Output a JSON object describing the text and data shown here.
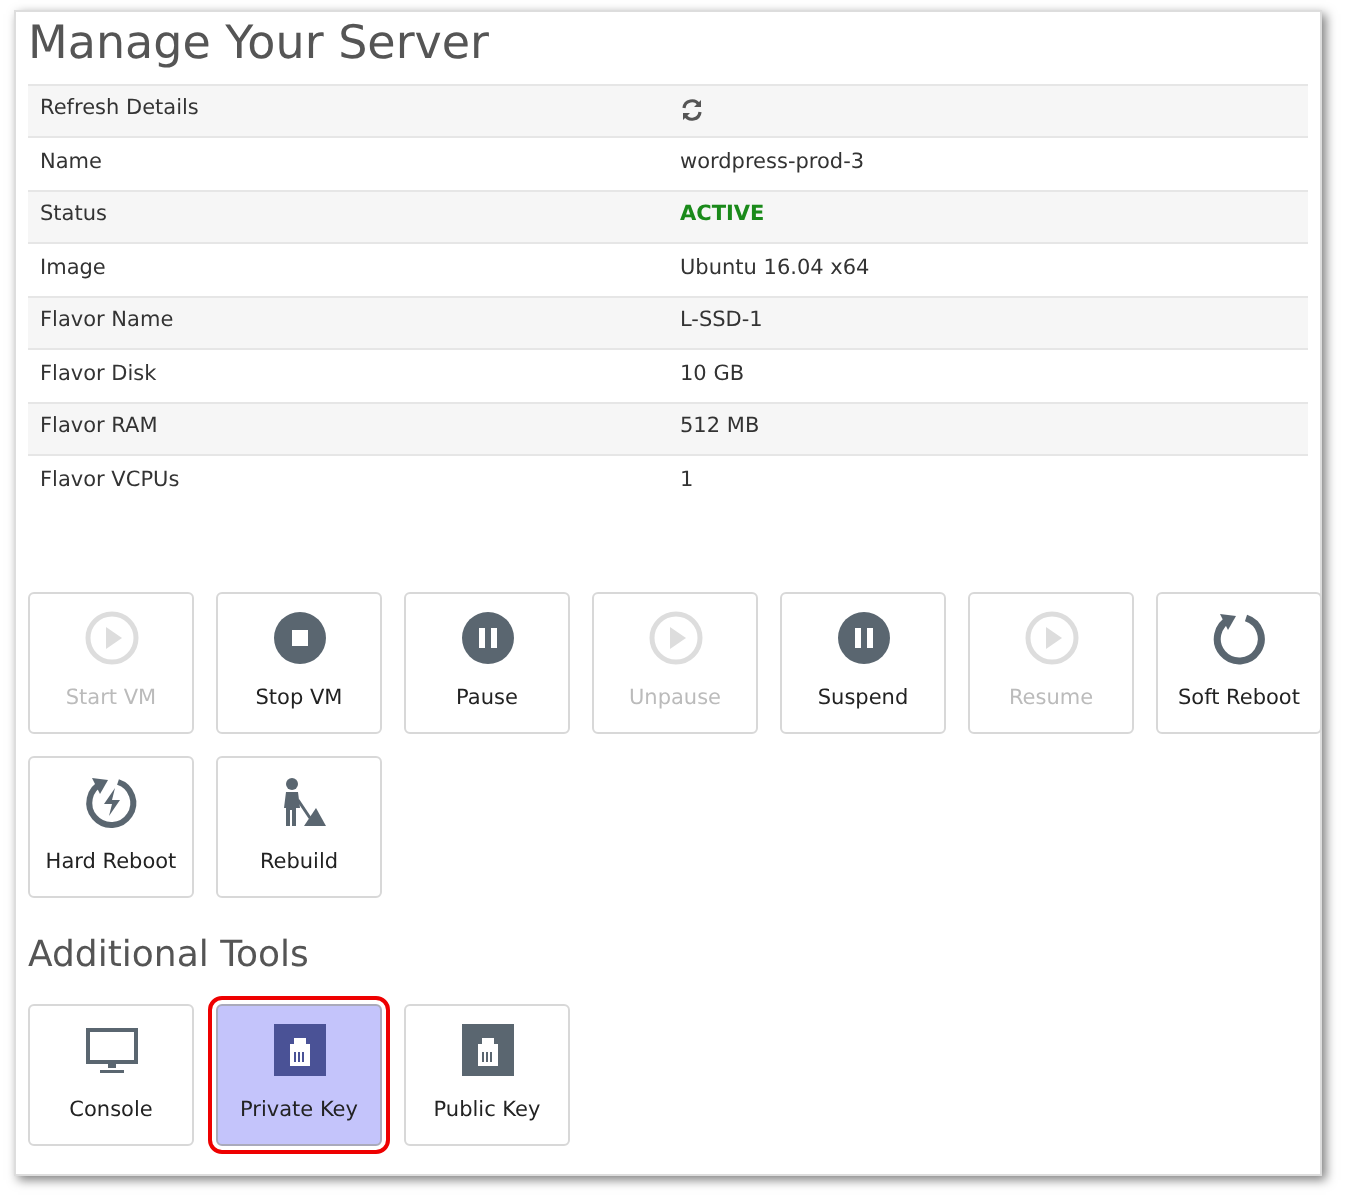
{
  "title": "Manage Your Server",
  "details": [
    {
      "label": "Refresh Details",
      "kind": "refresh"
    },
    {
      "label": "Name",
      "value": "wordpress-prod-3",
      "kind": "text"
    },
    {
      "label": "Status",
      "value": "ACTIVE",
      "kind": "status"
    },
    {
      "label": "Image",
      "value": "Ubuntu 16.04 x64",
      "kind": "text"
    },
    {
      "label": "Flavor Name",
      "value": "L-SSD-1",
      "kind": "text"
    },
    {
      "label": "Flavor Disk",
      "value": "10 GB",
      "kind": "text"
    },
    {
      "label": "Flavor RAM",
      "value": "512 MB",
      "kind": "text"
    },
    {
      "label": "Flavor VCPUs",
      "value": "1",
      "kind": "text"
    }
  ],
  "actions": [
    {
      "label": "Start VM",
      "kind": "play",
      "disabled": true
    },
    {
      "label": "Stop VM",
      "kind": "stop",
      "disabled": false
    },
    {
      "label": "Pause",
      "kind": "pause",
      "disabled": false
    },
    {
      "label": "Unpause",
      "kind": "play",
      "disabled": true
    },
    {
      "label": "Suspend",
      "kind": "pause",
      "disabled": false
    },
    {
      "label": "Resume",
      "kind": "play",
      "disabled": true
    },
    {
      "label": "Soft Reboot",
      "kind": "reboot",
      "disabled": false
    },
    {
      "label": "Hard Reboot",
      "kind": "hardreboot",
      "disabled": false
    },
    {
      "label": "Rebuild",
      "kind": "rebuild",
      "disabled": false
    }
  ],
  "tools_heading": "Additional Tools",
  "tools": [
    {
      "label": "Console",
      "kind": "monitor",
      "selected": false
    },
    {
      "label": "Private Key",
      "kind": "port",
      "selected": true
    },
    {
      "label": "Public Key",
      "kind": "port",
      "selected": false
    }
  ]
}
